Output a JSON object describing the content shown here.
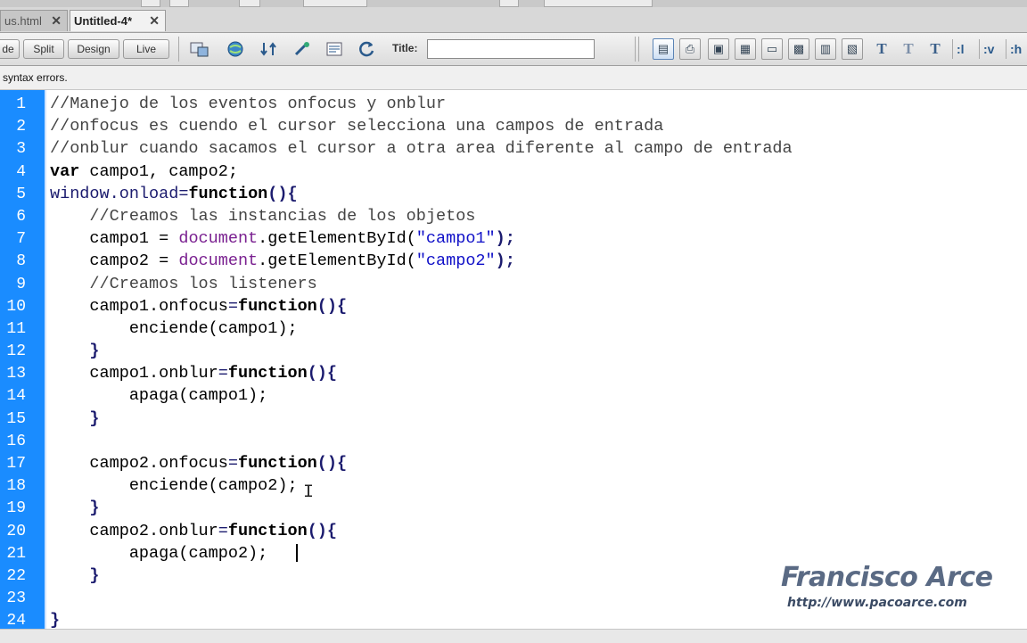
{
  "tabs": [
    {
      "label": "us.html",
      "close": "✕",
      "active": false
    },
    {
      "label": "Untitled-4*",
      "close": "✕",
      "active": true
    }
  ],
  "toolbar": {
    "view_buttons": [
      "de",
      "Split",
      "Design",
      "Live"
    ],
    "title_label": "Title:",
    "title_value": "",
    "text_styles": [
      "T",
      "T",
      "T"
    ],
    "selectors": [
      ":l",
      ":v",
      ":h"
    ]
  },
  "status": {
    "syntax_text": "syntax errors."
  },
  "editor": {
    "lines": [
      {
        "num": "1",
        "indent": 0,
        "tokens": [
          {
            "t": "//Manejo de los eventos onfocus y onblur",
            "c": "comment"
          }
        ]
      },
      {
        "num": "2",
        "indent": 0,
        "tokens": [
          {
            "t": "//onfocus es cuendo el cursor selecciona una campos de entrada",
            "c": "comment"
          }
        ]
      },
      {
        "num": "3",
        "indent": 0,
        "tokens": [
          {
            "t": "//onblur cuando sacamos el cursor a otra area diferente al campo de entrada",
            "c": "comment"
          }
        ]
      },
      {
        "num": "4",
        "indent": 0,
        "tokens": [
          {
            "t": "var",
            "c": "kw"
          },
          {
            "t": " campo1, campo2;",
            "c": "plain"
          }
        ]
      },
      {
        "num": "5",
        "indent": 0,
        "tokens": [
          {
            "t": "window",
            "c": "navy"
          },
          {
            "t": ".onload",
            "c": "navy"
          },
          {
            "t": "=",
            "c": "navy"
          },
          {
            "t": "function",
            "c": "kw"
          },
          {
            "t": "(){",
            "c": "punc"
          }
        ]
      },
      {
        "num": "6",
        "indent": 4,
        "tokens": [
          {
            "t": "//Creamos las instancias de los objetos",
            "c": "comment"
          }
        ]
      },
      {
        "num": "7",
        "indent": 4,
        "tokens": [
          {
            "t": "campo1 = ",
            "c": "plain"
          },
          {
            "t": "document",
            "c": "obj"
          },
          {
            "t": ".getElementById(",
            "c": "plain"
          },
          {
            "t": "\"campo1\"",
            "c": "str"
          },
          {
            "t": ");",
            "c": "punc"
          }
        ]
      },
      {
        "num": "8",
        "indent": 4,
        "tokens": [
          {
            "t": "campo2 = ",
            "c": "plain"
          },
          {
            "t": "document",
            "c": "obj"
          },
          {
            "t": ".getElementById(",
            "c": "plain"
          },
          {
            "t": "\"campo2\"",
            "c": "str"
          },
          {
            "t": ");",
            "c": "punc"
          }
        ]
      },
      {
        "num": "9",
        "indent": 4,
        "tokens": [
          {
            "t": "//Creamos los listeners",
            "c": "comment"
          }
        ]
      },
      {
        "num": "10",
        "indent": 4,
        "tokens": [
          {
            "t": "campo1.onfocus",
            "c": "plain"
          },
          {
            "t": "=",
            "c": "navy"
          },
          {
            "t": "function",
            "c": "kw"
          },
          {
            "t": "(){",
            "c": "punc"
          }
        ]
      },
      {
        "num": "11",
        "indent": 8,
        "tokens": [
          {
            "t": "enciende(campo1);",
            "c": "plain"
          }
        ]
      },
      {
        "num": "12",
        "indent": 4,
        "tokens": [
          {
            "t": "}",
            "c": "punc"
          }
        ]
      },
      {
        "num": "13",
        "indent": 4,
        "tokens": [
          {
            "t": "campo1.onblur",
            "c": "plain"
          },
          {
            "t": "=",
            "c": "navy"
          },
          {
            "t": "function",
            "c": "kw"
          },
          {
            "t": "(){",
            "c": "punc"
          }
        ]
      },
      {
        "num": "14",
        "indent": 8,
        "tokens": [
          {
            "t": "apaga(campo1);",
            "c": "plain"
          }
        ]
      },
      {
        "num": "15",
        "indent": 4,
        "tokens": [
          {
            "t": "}",
            "c": "punc"
          }
        ]
      },
      {
        "num": "16",
        "indent": 0,
        "tokens": []
      },
      {
        "num": "17",
        "indent": 4,
        "tokens": [
          {
            "t": "campo2.onfocus",
            "c": "plain"
          },
          {
            "t": "=",
            "c": "navy"
          },
          {
            "t": "function",
            "c": "kw"
          },
          {
            "t": "(){",
            "c": "punc"
          }
        ]
      },
      {
        "num": "18",
        "indent": 8,
        "tokens": [
          {
            "t": "enciende(campo2);",
            "c": "plain"
          }
        ]
      },
      {
        "num": "19",
        "indent": 4,
        "tokens": [
          {
            "t": "}",
            "c": "punc"
          }
        ]
      },
      {
        "num": "20",
        "indent": 4,
        "tokens": [
          {
            "t": "campo2.onblur",
            "c": "plain"
          },
          {
            "t": "=",
            "c": "navy"
          },
          {
            "t": "function",
            "c": "kw"
          },
          {
            "t": "(){",
            "c": "punc"
          }
        ]
      },
      {
        "num": "21",
        "indent": 8,
        "tokens": [
          {
            "t": "apaga(campo2);",
            "c": "plain"
          }
        ]
      },
      {
        "num": "22",
        "indent": 4,
        "tokens": [
          {
            "t": "}",
            "c": "punc"
          }
        ]
      },
      {
        "num": "23",
        "indent": 0,
        "tokens": []
      },
      {
        "num": "24",
        "indent": 0,
        "tokens": [
          {
            "t": "}",
            "c": "punc"
          }
        ]
      }
    ]
  },
  "watermark": {
    "name": "Francisco Arce",
    "url": "http://www.pacoarce.com"
  },
  "icons": [
    "inspect-icon",
    "globe-icon",
    "refresh-arrows-icon",
    "debug-icon",
    "file-manage-icon",
    "reload-icon",
    "code-view-icon",
    "print-icon",
    "preview-icon",
    "panel-icon",
    "browser-icon",
    "embed-icon",
    "media-icon",
    "grid-icon",
    "settings-icon"
  ]
}
